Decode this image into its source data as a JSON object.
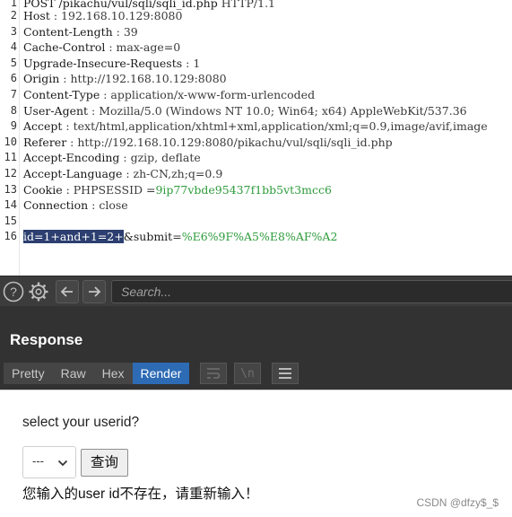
{
  "request": {
    "lines": [
      {
        "num": "1",
        "key": "POST /pikachu/vul/sqli/sqli_id.php",
        "value": " HTTP/1.1"
      },
      {
        "num": "2",
        "key": "Host",
        "value": " : 192.168.10.129:8080"
      },
      {
        "num": "3",
        "key": "Content-Length",
        "value": " : 39"
      },
      {
        "num": "4",
        "key": "Cache-Control",
        "value": " : max-age=0"
      },
      {
        "num": "5",
        "key": "Upgrade-Insecure-Requests",
        "value": "  : 1"
      },
      {
        "num": "6",
        "key": "Origin",
        "value": " : http://192.168.10.129:8080"
      },
      {
        "num": "7",
        "key": "Content-Type",
        "value": " : application/x-www-form-urlencoded"
      },
      {
        "num": "8",
        "key": "User-Agent",
        "value": " : Mozilla/5.0  (Windows  NT 10.0;  Win64;  x64) AppleWebKit/537.36"
      },
      {
        "num": "9",
        "key": "Accept",
        "value": " : text/html,application/xhtml+xml,application/xml;q=0.9,image/avif,image"
      },
      {
        "num": "10",
        "key": "Referer",
        "value": " : http://192.168.10.129:8080/pikachu/vul/sqli/sqli_id.php"
      },
      {
        "num": "11",
        "key": "Accept-Encoding",
        "value": " : gzip,  deflate"
      },
      {
        "num": "12",
        "key": "Accept-Language",
        "value": " : zh-CN,zh;q=0.9"
      },
      {
        "num": "13",
        "key": "Cookie",
        "value": " : PHPSESSID =",
        "value_colored": "9ip77vbde95437f1bb5vt3mcc6"
      },
      {
        "num": "14",
        "key": "Connection",
        "value": " : close"
      },
      {
        "num": "15",
        "key": "",
        "value": ""
      }
    ],
    "body_line": {
      "num": "16",
      "selected": "id=1+and+1=2+",
      "param_name": "&submit",
      "equals": "=",
      "param_value": "%E6%9F%A5%E8%AF%A2"
    }
  },
  "toolbar": {
    "search_placeholder": "Search..."
  },
  "response": {
    "title": "Response",
    "tabs": [
      {
        "label": "Pretty",
        "active": false
      },
      {
        "label": "Raw",
        "active": false
      },
      {
        "label": "Hex",
        "active": false
      },
      {
        "label": "Render",
        "active": true
      }
    ],
    "newline_label": "\\n",
    "render": {
      "prompt": "select your userid?",
      "select_value": "---",
      "query_button": "查询",
      "result": "您输入的user id不存在，请重新输入！"
    }
  },
  "watermark": "CSDN @dfzy$_$",
  "colors": {
    "accent_blue": "#2d6bb5",
    "selection": "#2c3f70",
    "value_green": "#2e9c3c",
    "panel_dark": "#323232"
  }
}
